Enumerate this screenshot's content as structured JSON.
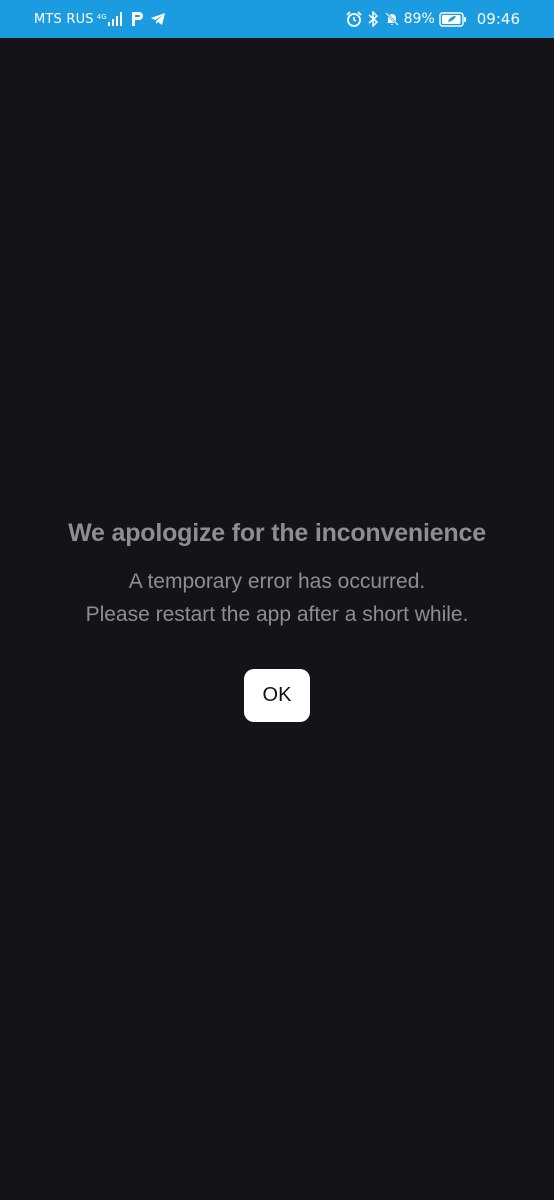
{
  "status_bar": {
    "carrier": "MTS RUS",
    "network_type": "4G",
    "network_sub": "+",
    "battery_percent": "89%",
    "time": "09:46",
    "icons": [
      "signal-bars-icon",
      "parking-app-icon",
      "telegram-icon",
      "alarm-icon",
      "bluetooth-icon",
      "mute-bell-icon",
      "battery-icon"
    ]
  },
  "error_dialog": {
    "title": "We apologize for the inconvenience",
    "message_lines": [
      "A temporary error has occurred.",
      "Please restart the app after a short while."
    ],
    "ok_label": "OK"
  },
  "colors": {
    "status_bar_bg": "#1b9be0",
    "background": "#141418",
    "text": "#8e8e92",
    "button_bg": "#ffffff"
  }
}
